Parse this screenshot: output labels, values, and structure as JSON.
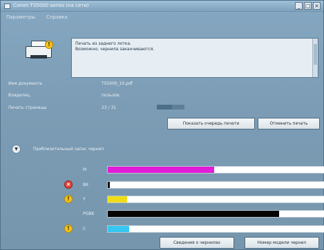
{
  "window": {
    "title": "Canon TS5000 series (на сети)",
    "minimize": "_",
    "maximize": "□",
    "close": "×"
  },
  "menu": [
    "Параметры",
    "Справка"
  ],
  "message": {
    "lines": [
      "Печать из заднего лотка.",
      "Возможно, чернила заканчиваются."
    ]
  },
  "info": [
    {
      "label": "Имя документа",
      "value": "TS5000_10.pdf"
    },
    {
      "label": "Владелец",
      "value": "пользов."
    },
    {
      "label": "Печать страницы",
      "value": "23 / 31"
    }
  ],
  "print_progress": 0.55,
  "buttons": {
    "show_queue": "Показать очередь печати",
    "cancel_print": "Отменить печать",
    "ink_details": "Сведения о чернилах",
    "ink_model": "Номер модели чернил"
  },
  "section": {
    "toggle": "▼",
    "title": "Приблизительный запас чернил"
  },
  "inks": [
    {
      "name": "M",
      "level": 0.49,
      "color": "#e21bd7",
      "alert": ""
    },
    {
      "name": "BK",
      "level": 0.01,
      "color": "#111111",
      "alert": "error"
    },
    {
      "name": "Y",
      "level": 0.09,
      "color": "#f1dc1a",
      "alert": "warning"
    },
    {
      "name": "PGBK",
      "level": 0.79,
      "color": "#050505",
      "alert": ""
    },
    {
      "name": "C",
      "level": 0.1,
      "color": "#35c6f1",
      "alert": "warning"
    }
  ],
  "icons": {
    "printer": "printer-icon",
    "warning": "!",
    "error": "×"
  }
}
